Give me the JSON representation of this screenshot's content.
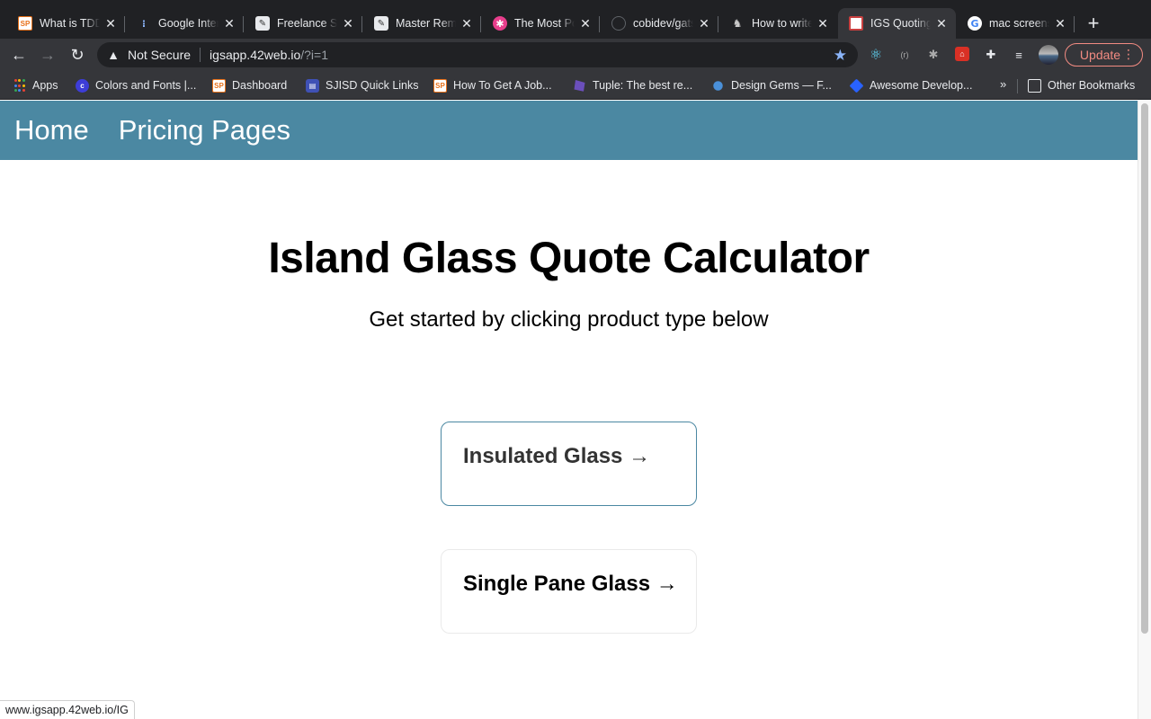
{
  "browser": {
    "tabs": [
      {
        "title": "What is TDD",
        "favicon": "sp-icon",
        "active": false
      },
      {
        "title": "Google Interview",
        "favicon": "gi-icon",
        "active": false
      },
      {
        "title": "Freelance Sites",
        "favicon": "fs-icon",
        "active": false
      },
      {
        "title": "Master Remote",
        "favicon": "fs-icon",
        "active": false
      },
      {
        "title": "The Most Popular",
        "favicon": "star-badge-icon",
        "active": false
      },
      {
        "title": "cobidev/gatsby",
        "favicon": "github-icon",
        "active": false
      },
      {
        "title": "How to write",
        "favicon": "dev-icon",
        "active": false
      },
      {
        "title": "IGS Quoting",
        "favicon": "igs-icon",
        "active": true
      },
      {
        "title": "mac screenshot",
        "favicon": "google-icon",
        "active": false
      }
    ],
    "close_glyph": "✕",
    "new_tab_glyph": "+",
    "toolbar": {
      "back_glyph": "←",
      "forward_glyph": "→",
      "reload_glyph": "↻",
      "security_label": "Not Secure",
      "url_host": "igsapp.42web.io",
      "url_rest": "/?i=1",
      "update_label": "Update"
    },
    "bookmarks": [
      {
        "label": "Apps",
        "favicon": "apps-grid-icon"
      },
      {
        "label": "Colors and Fonts |...",
        "favicon": "colors-fonts-icon"
      },
      {
        "label": "Dashboard",
        "favicon": "sp-icon"
      },
      {
        "label": "SJISD Quick Links",
        "favicon": "sjisd-icon"
      },
      {
        "label": "How To Get A Job...",
        "favicon": "sp-icon"
      },
      {
        "label": "Tuple: The best re...",
        "favicon": "tuple-icon"
      },
      {
        "label": "Design Gems — F...",
        "favicon": "design-gems-icon"
      },
      {
        "label": "Awesome Develop...",
        "favicon": "awesome-icon"
      }
    ],
    "bookmarks_more": "»",
    "other_bookmarks": "Other Bookmarks",
    "status_url": "www.igsapp.42web.io/IG"
  },
  "site": {
    "nav": [
      {
        "label": "Home"
      },
      {
        "label": "Pricing Pages"
      }
    ],
    "title": "Island Glass Quote Calculator",
    "subtitle": "Get started by clicking product type below",
    "products": [
      {
        "label": "Insulated Glass →",
        "hovered": true
      },
      {
        "label": "Single Pane Glass →",
        "hovered": false
      }
    ]
  },
  "colors": {
    "nav_bar": "#4b88a2",
    "chrome_dark": "#202124",
    "chrome_toolbar": "#35363a",
    "update_accent": "#f28b82"
  }
}
